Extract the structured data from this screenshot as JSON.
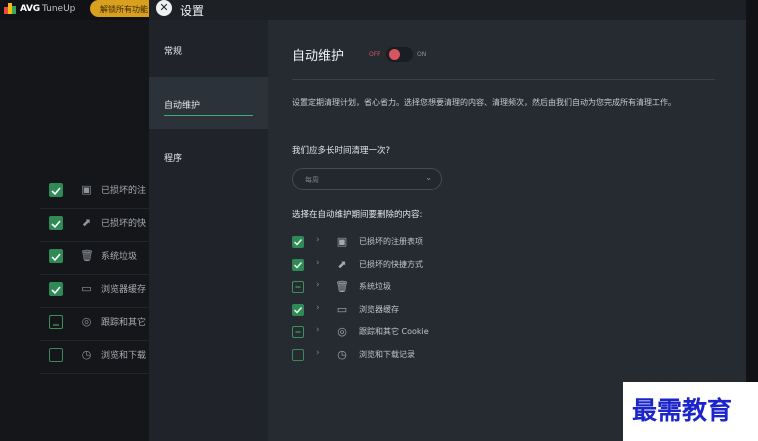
{
  "background_app": {
    "app_name": "AVG",
    "product": "TuneUp",
    "unlock_button": "解锁所有功能",
    "items": [
      {
        "label": "已损坏的注",
        "state": "checked",
        "icon": "registry-icon"
      },
      {
        "label": "已损坏的快",
        "state": "checked",
        "icon": "shortcut-icon"
      },
      {
        "label": "系统垃圾",
        "state": "checked",
        "icon": "trash-icon"
      },
      {
        "label": "浏览器缓存",
        "state": "checked",
        "icon": "browser-icon"
      },
      {
        "label": "跟踪和其它",
        "state": "partial",
        "icon": "tracking-icon"
      },
      {
        "label": "浏览和下载",
        "state": "empty",
        "icon": "clock-icon"
      }
    ]
  },
  "dialog": {
    "title": "设置",
    "nav": [
      {
        "label": "常规",
        "active": false
      },
      {
        "label": "自动维护",
        "active": true
      },
      {
        "label": "程序",
        "active": false
      }
    ],
    "section_title": "自动维护",
    "toggle": {
      "off_label": "OFF",
      "on_label": "ON",
      "state": "off"
    },
    "description": "设置定期清理计划，省心省力。选择您想要清理的内容、清理频次，然后由我们自动为您完成所有清理工作。",
    "frequency_question": "我们应多长时间清理一次?",
    "frequency_value": "每周",
    "items_question": "选择在自动维护期间要删除的内容:",
    "items": [
      {
        "label": "已损坏的注册表项",
        "state": "checked",
        "icon": "registry-icon"
      },
      {
        "label": "已损坏的快捷方式",
        "state": "checked",
        "icon": "shortcut-icon"
      },
      {
        "label": "系统垃圾",
        "state": "partial",
        "icon": "trash-icon"
      },
      {
        "label": "浏览器缓存",
        "state": "checked",
        "icon": "browser-icon"
      },
      {
        "label": "跟踪和其它 Cookie",
        "state": "partial",
        "icon": "tracking-icon"
      },
      {
        "label": "浏览和下载记录",
        "state": "empty",
        "icon": "clock-icon"
      }
    ]
  },
  "watermark": "最需教育",
  "colors": {
    "accent_green": "#2f8a55",
    "toggle_red": "#d8545f",
    "unlock_gold": "#d99f1f",
    "watermark_blue": "#1b25c9"
  }
}
